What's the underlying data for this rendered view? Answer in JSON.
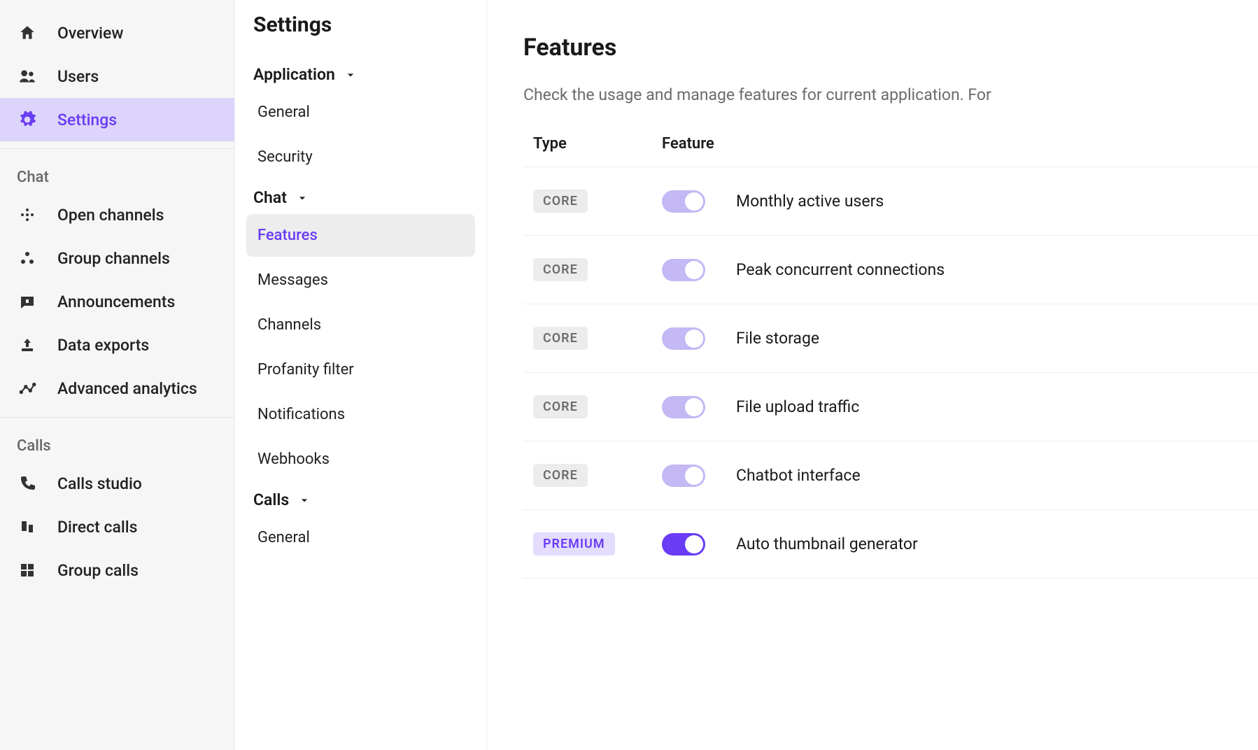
{
  "sidebar": {
    "items": [
      {
        "label": "Overview",
        "icon": "home"
      },
      {
        "label": "Users",
        "icon": "users"
      },
      {
        "label": "Settings",
        "icon": "gear",
        "active": true
      }
    ],
    "sections": [
      {
        "title": "Chat",
        "items": [
          {
            "label": "Open channels",
            "icon": "dots"
          },
          {
            "label": "Group channels",
            "icon": "triangle-dots"
          },
          {
            "label": "Announcements",
            "icon": "announce"
          },
          {
            "label": "Data exports",
            "icon": "export"
          },
          {
            "label": "Advanced analytics",
            "icon": "analytics"
          }
        ]
      },
      {
        "title": "Calls",
        "items": [
          {
            "label": "Calls studio",
            "icon": "phone"
          },
          {
            "label": "Direct calls",
            "icon": "bars"
          },
          {
            "label": "Group calls",
            "icon": "grid"
          }
        ]
      }
    ]
  },
  "settingsNav": {
    "title": "Settings",
    "groups": [
      {
        "label": "Application",
        "items": [
          "General",
          "Security"
        ]
      },
      {
        "label": "Chat",
        "items": [
          "Features",
          "Messages",
          "Channels",
          "Profanity filter",
          "Notifications",
          "Webhooks"
        ],
        "activeItem": "Features"
      },
      {
        "label": "Calls",
        "items": [
          "General"
        ]
      }
    ]
  },
  "main": {
    "title": "Features",
    "subtitle": "Check the usage and manage features for current application. For",
    "columns": {
      "type": "Type",
      "feature": "Feature"
    },
    "rows": [
      {
        "type": "CORE",
        "typeClass": "core",
        "on": "light",
        "name": "Monthly active users"
      },
      {
        "type": "CORE",
        "typeClass": "core",
        "on": "light",
        "name": "Peak concurrent connections"
      },
      {
        "type": "CORE",
        "typeClass": "core",
        "on": "light",
        "name": "File storage"
      },
      {
        "type": "CORE",
        "typeClass": "core",
        "on": "light",
        "name": "File upload traffic"
      },
      {
        "type": "CORE",
        "typeClass": "core",
        "on": "light",
        "name": "Chatbot interface"
      },
      {
        "type": "PREMIUM",
        "typeClass": "premium",
        "on": "strong",
        "name": "Auto thumbnail generator"
      }
    ]
  }
}
